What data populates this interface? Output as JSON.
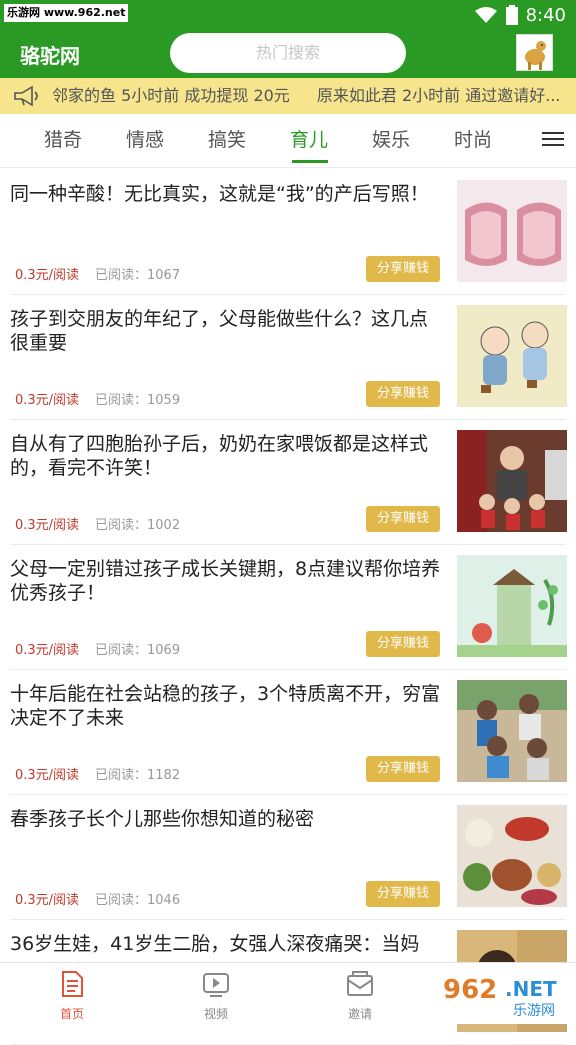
{
  "status": {
    "watermark": "乐游网 www.962.net",
    "time": "8:40"
  },
  "header": {
    "title": "骆驼网",
    "search_placeholder": "热门搜索"
  },
  "ticker": {
    "messages": [
      "邻家的鱼 5小时前 成功提现 20元",
      "原来如此君 2小时前 通过邀请好..."
    ]
  },
  "tabs": [
    {
      "label": "猎奇"
    },
    {
      "label": "情感"
    },
    {
      "label": "搞笑"
    },
    {
      "label": "育儿",
      "active": true
    },
    {
      "label": "娱乐"
    },
    {
      "label": "时尚"
    }
  ],
  "articles": [
    {
      "title": "同一种辛酸！无比真实，这就是“我”的产后写照！",
      "price": "0.3元/阅读",
      "reads": "已阅读：1067",
      "share": "分享赚钱"
    },
    {
      "title": "孩子到交朋友的年纪了，父母能做些什么？这几点很重要",
      "price": "0.3元/阅读",
      "reads": "已阅读：1059",
      "share": "分享赚钱"
    },
    {
      "title": "自从有了四胞胎孙子后，奶奶在家喂饭都是这样式的，看完不许笑！",
      "price": "0.3元/阅读",
      "reads": "已阅读：1002",
      "share": "分享赚钱"
    },
    {
      "title": "父母一定别错过孩子成长关键期，8点建议帮你培养优秀孩子！",
      "price": "0.3元/阅读",
      "reads": "已阅读：1069",
      "share": "分享赚钱"
    },
    {
      "title": "十年后能在社会站稳的孩子，3个特质离不开，穷富决定不了未来",
      "price": "0.3元/阅读",
      "reads": "已阅读：1182",
      "share": "分享赚钱"
    },
    {
      "title": "春季孩子长个儿那些你想知道的秘密",
      "price": "0.3元/阅读",
      "reads": "已阅读：1046",
      "share": "分享赚钱"
    },
    {
      "title": "36岁生娃，41岁生二胎，女强人深夜痛哭：当妈"
    }
  ],
  "bottom_nav": [
    {
      "label": "首页",
      "active": true,
      "icon": "document-icon"
    },
    {
      "label": "视频",
      "icon": "video-icon"
    },
    {
      "label": "邀请",
      "icon": "envelope-icon"
    }
  ],
  "colors": {
    "brand": "#2b9a24",
    "ticker_bg": "#f6e58d",
    "share_button": "#e1b84a",
    "price": "#c0392b",
    "nav_active": "#e0533a"
  }
}
